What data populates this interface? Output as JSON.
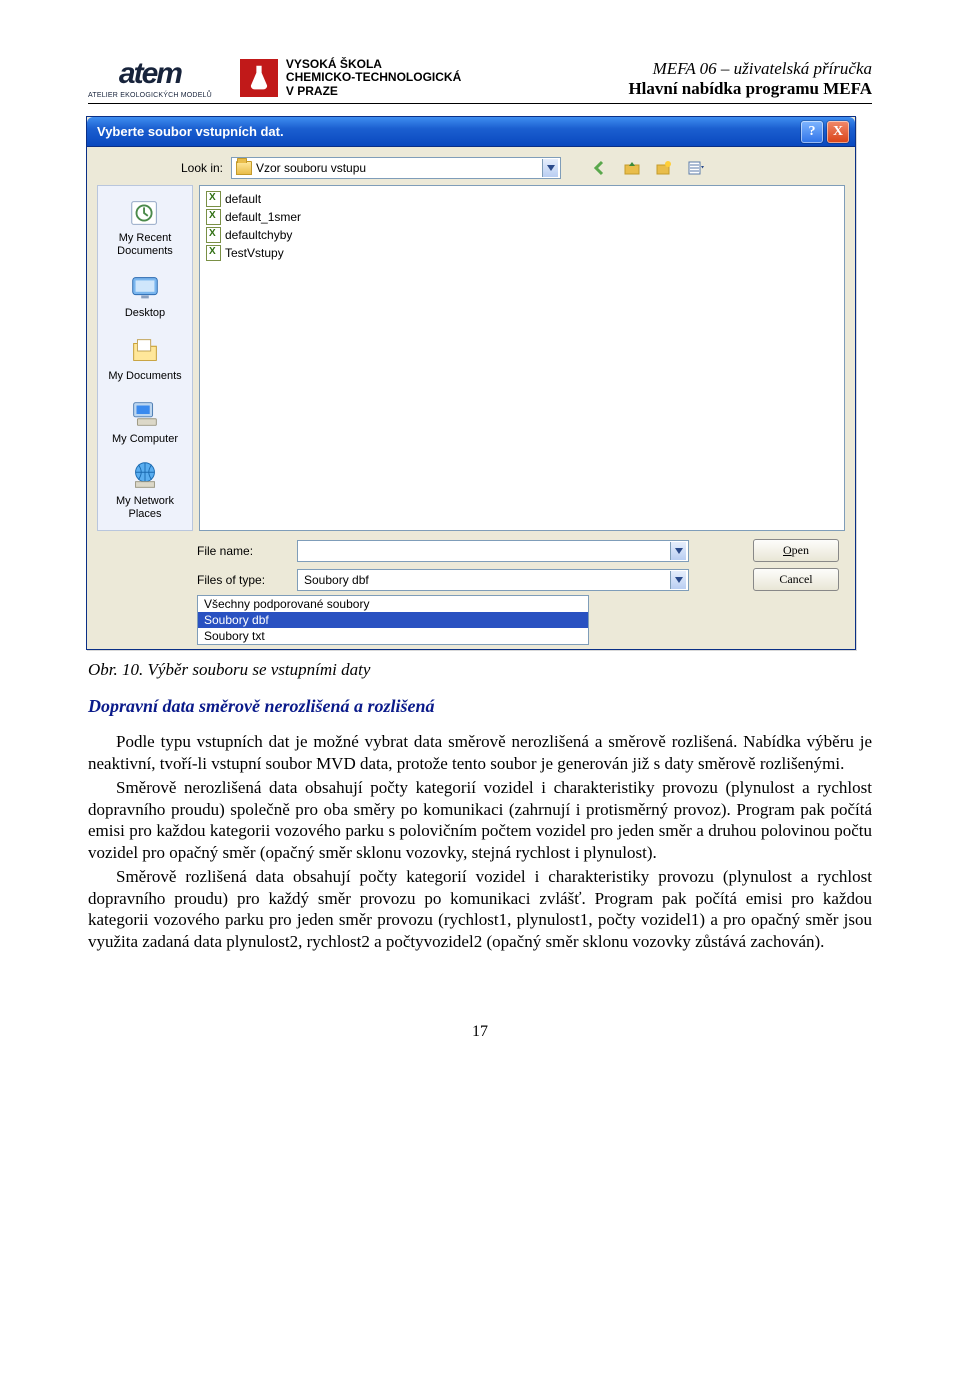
{
  "header": {
    "logo_atem_text": "atem",
    "logo_atem_sub": "ATELIER EKOLOGICKÝCH MODELŮ",
    "vscht_line1": "VYSOKÁ ŠKOLA",
    "vscht_line2": "CHEMICKO-TECHNOLOGICKÁ",
    "vscht_line3": "V PRAZE",
    "right_line1": "MEFA 06 – uživatelská příručka",
    "right_line2": "Hlavní nabídka programu MEFA"
  },
  "dialog": {
    "title": "Vyberte soubor vstupních dat.",
    "lookin_label": "Look in:",
    "lookin_value": "Vzor souboru vstupu",
    "places": [
      "My Recent Documents",
      "Desktop",
      "My Documents",
      "My Computer",
      "My Network Places"
    ],
    "files": [
      "default",
      "default_1smer",
      "defaultchyby",
      "TestVstupy"
    ],
    "filename_label": "File name:",
    "filename_value": "",
    "filetype_label": "Files of type:",
    "filetype_value": "Soubory dbf",
    "filetype_options": [
      "Všechny podporované soubory",
      "Soubory dbf",
      "Soubory txt"
    ],
    "open_btn": "Open",
    "cancel_btn": "Cancel",
    "title_help": "?",
    "title_close": "X"
  },
  "body": {
    "caption": "Obr. 10. Výběr souboru se vstupními daty",
    "section_title": "Dopravní data směrově nerozlišená a rozlišená",
    "p1": "Podle typu vstupních dat je možné vybrat data směrově nerozlišená a směrově rozlišená. Nabídka výběru je neaktivní, tvoří-li vstupní soubor MVD data, protože tento soubor je generován již s daty směrově rozlišenými.",
    "p2": "Směrově nerozlišená data obsahují počty kategorií vozidel i charakteristiky provozu (plynulost a rychlost dopravního proudu) společně pro oba směry po komunikaci (zahrnují i protisměrný provoz). Program pak počítá emisi pro každou kategorii vozového parku s polovičním počtem vozidel pro jeden směr a druhou polovinou počtu vozidel pro opačný směr (opačný směr sklonu vozovky, stejná rychlost i plynulost).",
    "p3": "Směrově rozlišená data obsahují počty kategorií vozidel i charakteristiky provozu (plynulost a rychlost dopravního proudu) pro každý směr provozu po komunikaci zvlášť. Program pak počítá emisi pro každou kategorii vozového parku pro jeden směr provozu (rychlost1, plynulost1, počty vozidel1) a pro opačný směr jsou využita zadaná data plynulost2, rychlost2 a počtyvozidel2 (opačný směr sklonu vozovky zůstává zachován).",
    "page_num": "17"
  }
}
